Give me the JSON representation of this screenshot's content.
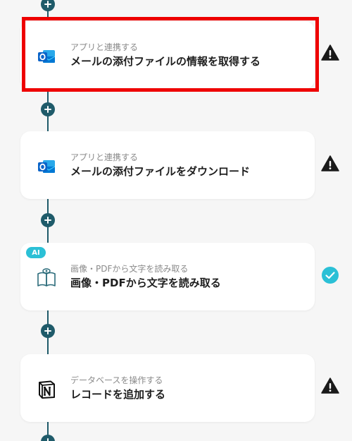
{
  "flow": {
    "steps": [
      {
        "subtitle": "アプリと連携する",
        "title": "メールの添付ファイルの情報を取得する",
        "icon": "outlook-icon",
        "status": "warning-icon",
        "selected": true
      },
      {
        "subtitle": "アプリと連携する",
        "title": "メールの添付ファイルをダウンロード",
        "icon": "outlook-icon",
        "status": "warning-icon"
      },
      {
        "subtitle": "画像・PDFから文字を読み取る",
        "title": "画像・PDFから文字を読み取る",
        "icon": "ocr-book-icon",
        "status": "check-icon",
        "badge": "AI"
      },
      {
        "subtitle": "データベースを操作する",
        "title": "レコードを追加する",
        "icon": "notion-icon",
        "status": "warning-icon"
      }
    ]
  },
  "colors": {
    "connector": "#1f5b6a",
    "highlight": "#ee0000",
    "ai_badge": "#2bc0d6",
    "success": "#2bc0d6",
    "outlook_blue": "#0a64c8"
  }
}
